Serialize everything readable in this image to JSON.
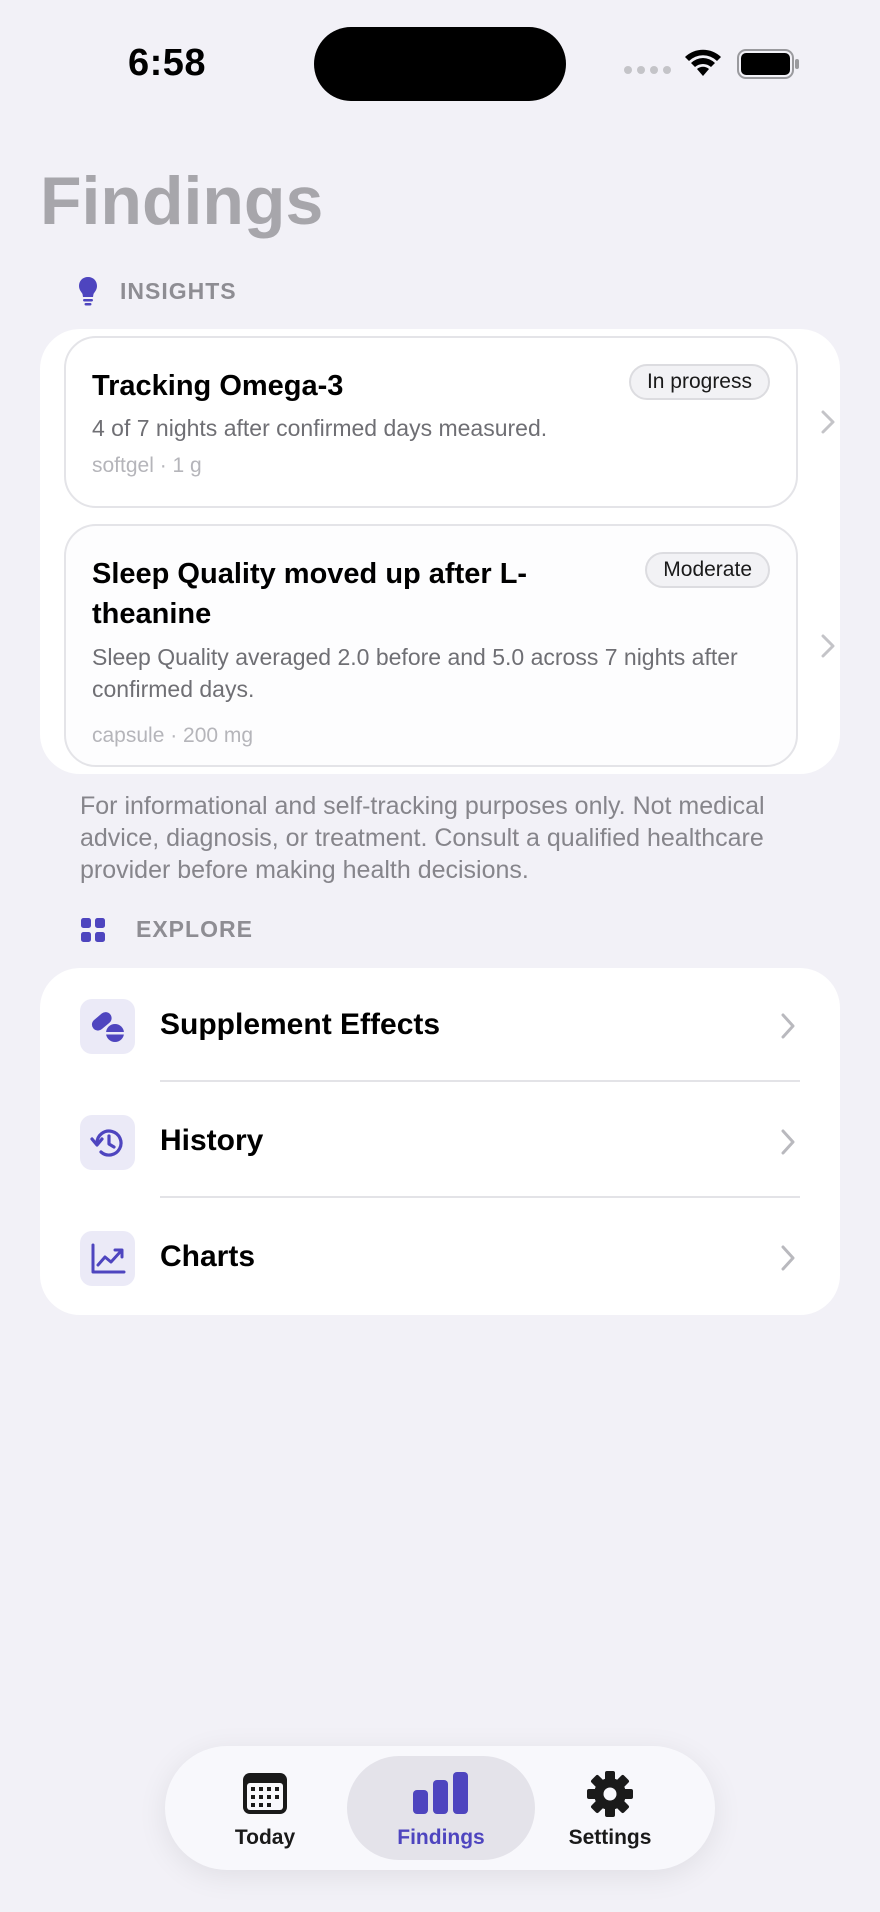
{
  "status_bar": {
    "time": "6:58"
  },
  "page_title": "Findings",
  "insights": {
    "section_label": "INSIGHTS",
    "items": [
      {
        "title": "Tracking Omega-3",
        "badge": "In progress",
        "description": "4 of 7 nights after confirmed days measured.",
        "meta": "softgel · 1 g"
      },
      {
        "title": "Sleep Quality moved up after L-theanine",
        "badge": "Moderate",
        "description": "Sleep Quality averaged 2.0 before and 5.0 across 7 nights after confirmed days.",
        "meta": "capsule · 200 mg"
      }
    ]
  },
  "disclaimer": "For informational and self-tracking purposes only. Not medical advice, diagnosis, or treatment. Consult a qualified healthcare provider before making health decisions.",
  "explore": {
    "section_label": "EXPLORE",
    "items": [
      {
        "label": "Supplement Effects",
        "icon": "pills-icon"
      },
      {
        "label": "History",
        "icon": "history-icon"
      },
      {
        "label": "Charts",
        "icon": "chart-line-icon"
      }
    ]
  },
  "tab_bar": {
    "tabs": [
      {
        "label": "Today",
        "icon": "calendar-icon",
        "selected": false
      },
      {
        "label": "Findings",
        "icon": "bar-chart-icon",
        "selected": true
      },
      {
        "label": "Settings",
        "icon": "gear-icon",
        "selected": false
      }
    ]
  },
  "colors": {
    "accent": "#4e45bf",
    "background": "#f2f1f7",
    "card": "#ffffff",
    "secondary_text": "#86858b"
  }
}
